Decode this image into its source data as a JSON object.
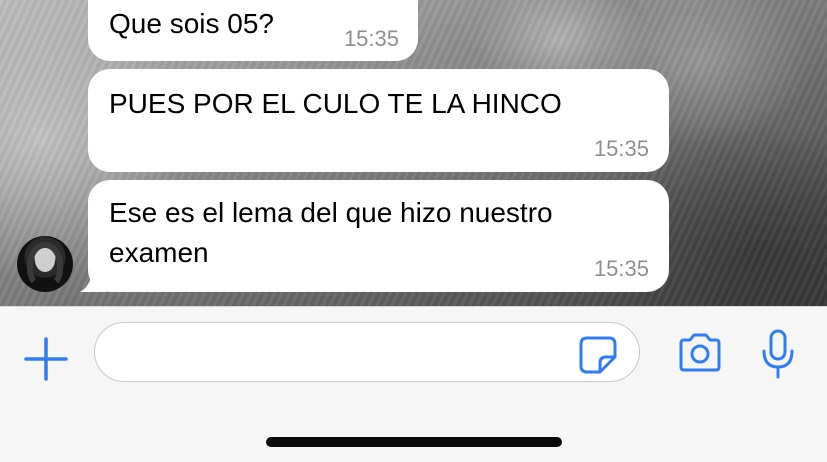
{
  "messages": [
    {
      "text": "Que sois 05?",
      "time": "15:35"
    },
    {
      "text": "PUES POR EL CULO TE LA HINCO",
      "time": "15:35"
    },
    {
      "text": "Ese es el lema del que hizo nuestro examen",
      "time": "15:35"
    }
  ],
  "composer": {
    "input_value": "",
    "icons": [
      "plus-icon",
      "sticker-icon",
      "camera-icon",
      "microphone-icon"
    ]
  },
  "colors": {
    "accent": "#2f7df6",
    "bubble": "#ffffff",
    "timestamp": "#8e8e93",
    "bar_background": "#f6f6f6"
  }
}
